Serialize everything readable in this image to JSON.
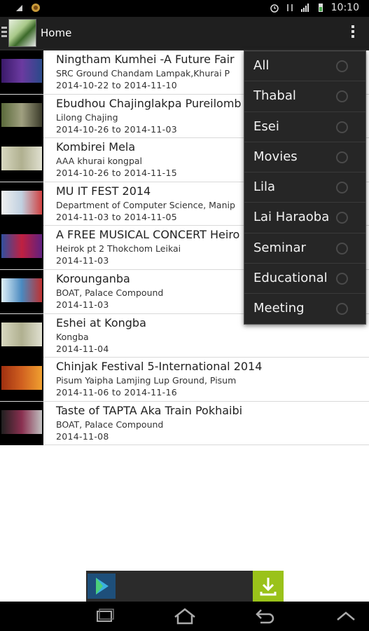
{
  "status_bar": {
    "time": "10:10",
    "icons": [
      "usb-icon",
      "notification-icon",
      "alarm-icon",
      "data-icon",
      "signal-icon",
      "battery-icon"
    ]
  },
  "action_bar": {
    "title": "Home",
    "icons": [
      "drawer-icon",
      "app-logo",
      "overflow-menu-icon"
    ]
  },
  "events": [
    {
      "title": "Ningtham Kumhei -A Future Fair",
      "place": "SRC Ground Chandam Lampak,Khurai P",
      "date": "2014-10-22  to  2014-11-10",
      "thumb_color": "#6b3aa0"
    },
    {
      "title": "Ebudhou Chajinglakpa Pureilomb",
      "place": "Lilong Chajing",
      "date": "2014-10-26  to  2014-11-03",
      "thumb_color": "#7a8a5a"
    },
    {
      "title": "Kombirei Mela",
      "place": "AAA khurai kongpal",
      "date": "2014-10-26  to  2014-11-15",
      "thumb_color": "#c9c9a8"
    },
    {
      "title": "MU IT FEST 2014",
      "place": "Department of Computer Science, Manip",
      "date": "2014-11-03  to  2014-11-05",
      "thumb_color": "#e8e8e8"
    },
    {
      "title": "A FREE MUSICAL CONCERT Heiro",
      "place": "Heirok pt 2 Thokchom Leikai",
      "date": "2014-11-03",
      "thumb_color": "#c02040"
    },
    {
      "title": "Korounganba",
      "place": "BOAT, Palace Compound",
      "date": "2014-11-03",
      "thumb_color": "#4a8ac0"
    },
    {
      "title": "Eshei at Kongba",
      "place": "Kongba",
      "date": "2014-11-04",
      "thumb_color": "#c9c9a8"
    },
    {
      "title": "Chinjak Festival 5-International 2014",
      "place": "Pisum Yaipha Lamjing Lup Ground,  Pisum",
      "date": "2014-11-06  to  2014-11-16",
      "thumb_color": "#d06020"
    },
    {
      "title": "Taste of TAPTA Aka Train Pokhaibi",
      "place": "BOAT, Palace Compound",
      "date": "2014-11-08",
      "thumb_color": "#8a3050"
    }
  ],
  "filter_menu": {
    "items": [
      {
        "label": "All"
      },
      {
        "label": "Thabal"
      },
      {
        "label": "Esei"
      },
      {
        "label": "Movies"
      },
      {
        "label": "Lila"
      },
      {
        "label": "Lai Haraoba"
      },
      {
        "label": "Seminar"
      },
      {
        "label": "Educational"
      },
      {
        "label": "Meeting"
      }
    ]
  },
  "ad_banner": {
    "icons": [
      "play-store-icon",
      "download-icon"
    ],
    "colors": {
      "download_bg": "#9ac21a",
      "play_bg": "#1e4f7a"
    }
  },
  "nav_bar": {
    "icons": [
      "recent-apps-icon",
      "home-icon",
      "back-icon",
      "up-icon"
    ]
  }
}
